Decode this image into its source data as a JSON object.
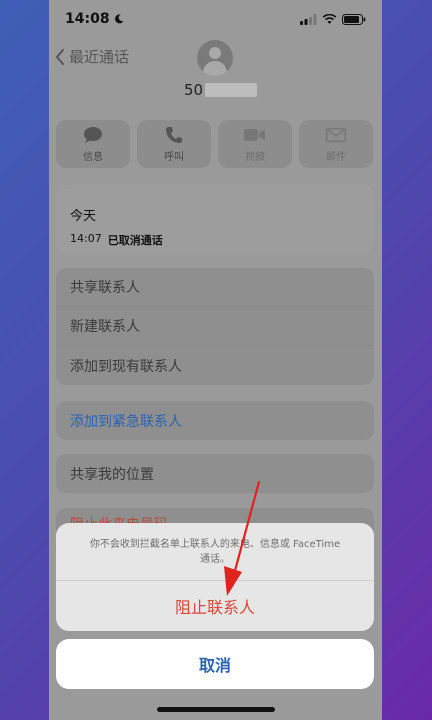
{
  "status_bar": {
    "time": "14:08"
  },
  "nav": {
    "back_label": "最近通话"
  },
  "contact": {
    "number_prefix": "50"
  },
  "actions": [
    {
      "label": "信息",
      "icon": "message-icon",
      "enabled": true
    },
    {
      "label": "呼叫",
      "icon": "phone-icon",
      "enabled": true
    },
    {
      "label": "视频",
      "icon": "video-icon",
      "enabled": false
    },
    {
      "label": "邮件",
      "icon": "mail-icon",
      "enabled": false
    }
  ],
  "recent": {
    "day": "今天",
    "time": "14:07",
    "status": "已取消通话"
  },
  "menu_group1": [
    "共享联系人",
    "新建联系人",
    "添加到现有联系人"
  ],
  "menu_group2": [
    "添加到紧急联系人"
  ],
  "menu_group3": [
    "共享我的位置"
  ],
  "menu_group4": [
    "阻止此来电号码"
  ],
  "sheet": {
    "message": "你不会收到拦截名单上联系人的来电、信息或 FaceTime 通话。",
    "block_label": "阻止联系人",
    "cancel_label": "取消"
  },
  "colors": {
    "link_blue": "#2b62b3",
    "destructive_red": "#d9483b",
    "annotation_red": "#e2221c"
  }
}
